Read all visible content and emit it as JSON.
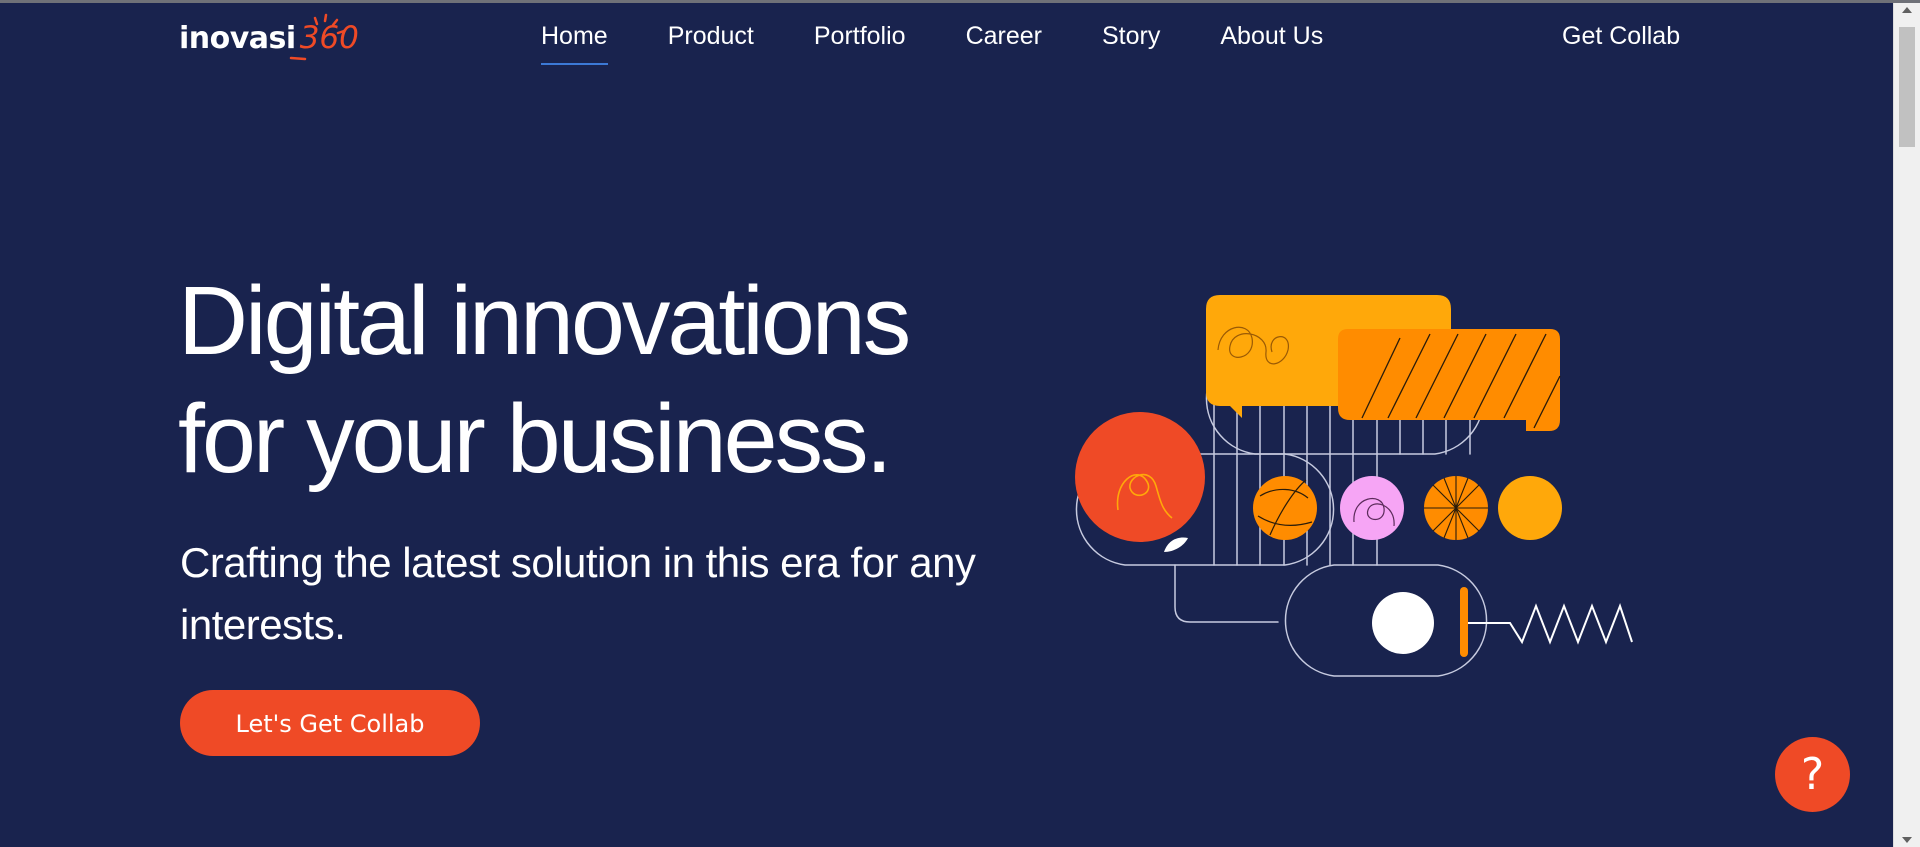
{
  "brand": {
    "name": "inovasi",
    "number": "360",
    "accent": "#ef4a26"
  },
  "nav": {
    "items": [
      {
        "label": "Home",
        "active": true
      },
      {
        "label": "Product"
      },
      {
        "label": "Portfolio"
      },
      {
        "label": "Career"
      },
      {
        "label": "Story"
      },
      {
        "label": "About Us"
      }
    ],
    "cta_label": "Get Collab"
  },
  "hero": {
    "title_line1": "Digital innovations",
    "title_line2": "for your business.",
    "subtitle": "Crafting the latest solution in this era for any interests.",
    "button_label": "Let's Get Collab"
  },
  "help": {
    "label": "?"
  },
  "colors": {
    "background": "#19234e",
    "accent": "#ef4a26",
    "amber": "#ffa80a",
    "orange": "#ff8c00",
    "pink": "#f6a5f5",
    "nav_underline": "#3c79d6"
  }
}
